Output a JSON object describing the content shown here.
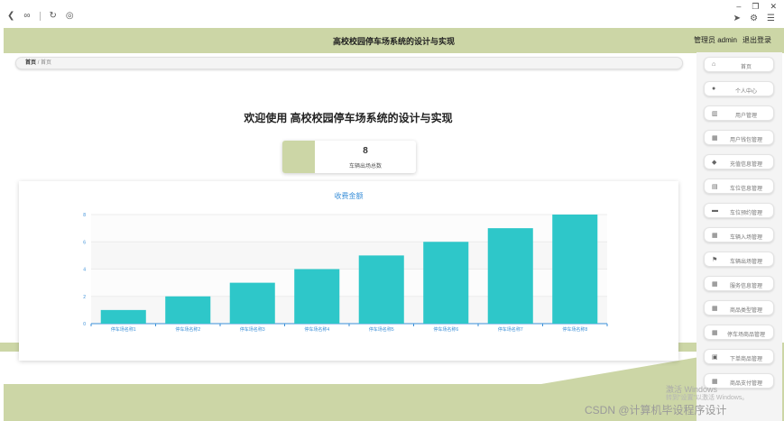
{
  "header": {
    "title": "高校校园停车场系统的设计与实现",
    "user_label": "管理员 admin",
    "logout_label": "退出登录"
  },
  "breadcrumb": {
    "home": "首页",
    "current": "首页"
  },
  "sidebar": {
    "items": [
      {
        "label": "首页",
        "icon": "home-icon",
        "glyph": "⌂"
      },
      {
        "label": "个人中心",
        "icon": "person-icon",
        "glyph": "●"
      },
      {
        "label": "用户管理",
        "icon": "bar-chart-icon",
        "glyph": "▥"
      },
      {
        "label": "用户钱包管理",
        "icon": "grid-icon",
        "glyph": "▦"
      },
      {
        "label": "充值信息管理",
        "icon": "pin-icon",
        "glyph": "◆"
      },
      {
        "label": "车位信息管理",
        "icon": "list-icon",
        "glyph": "▤"
      },
      {
        "label": "车位预约管理",
        "icon": "building-icon",
        "glyph": "▬"
      },
      {
        "label": "车辆入场管理",
        "icon": "grid-icon",
        "glyph": "▦"
      },
      {
        "label": "车辆出场管理",
        "icon": "flag-icon",
        "glyph": "⚑"
      },
      {
        "label": "服务信息管理",
        "icon": "grid-icon",
        "glyph": "▦"
      },
      {
        "label": "商品类型管理",
        "icon": "grid-icon",
        "glyph": "▦"
      },
      {
        "label": "停车场商品管理",
        "icon": "grid-icon",
        "glyph": "▦"
      },
      {
        "label": "下单商品管理",
        "icon": "doc-icon",
        "glyph": "▣"
      },
      {
        "label": "商品支付管理",
        "icon": "grid-icon",
        "glyph": "▦"
      }
    ]
  },
  "welcome": "欢迎使用 高校校园停车场系统的设计与实现",
  "stat": {
    "value": "8",
    "caption": "车辆出场总数"
  },
  "chart_data": {
    "type": "bar",
    "title": "收费金额",
    "categories": [
      "停车场名称1",
      "停车场名称2",
      "停车场名称3",
      "停车场名称4",
      "停车场名称5",
      "停车场名称6",
      "停车场名称7",
      "停车场名称8"
    ],
    "values": [
      1,
      2,
      3,
      4,
      5,
      6,
      7,
      8
    ],
    "yticks": [
      0,
      2,
      4,
      6,
      8
    ],
    "ylim": [
      0,
      8
    ],
    "bar_color": "#2ec7c9",
    "grid": true
  },
  "watermark": {
    "line1": "激活 Windows",
    "line2": "转到\"设置\"以激活 Windows。",
    "csdn": "CSDN @计算机毕设程序设计"
  }
}
